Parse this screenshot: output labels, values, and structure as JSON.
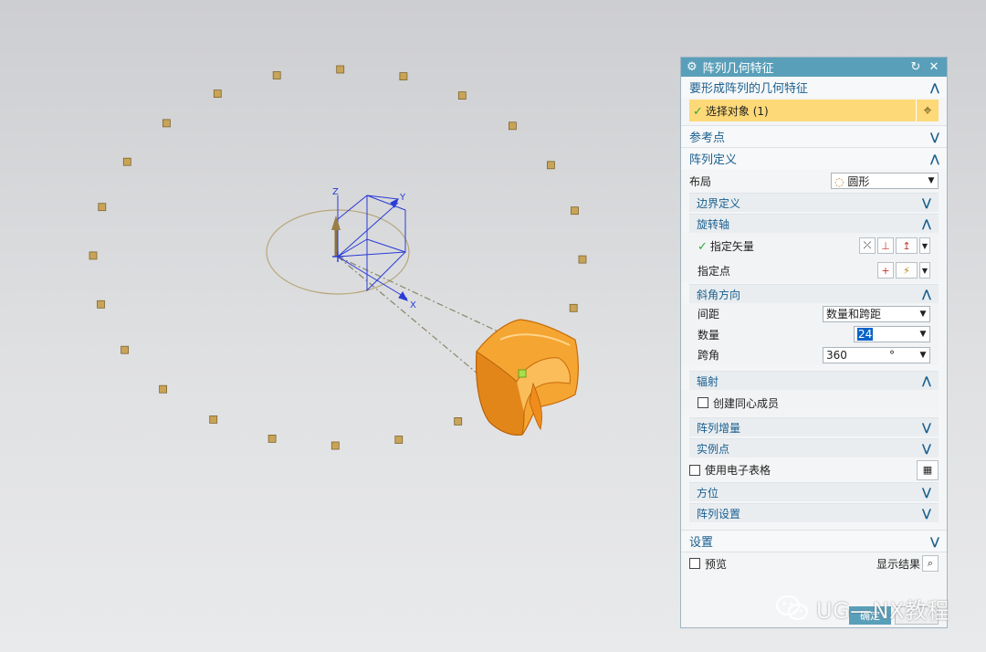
{
  "dialog": {
    "title": "阵列几何特征",
    "groups": {
      "features": {
        "label": "要形成阵列的几何特征",
        "select_label": "选择对象 (1)"
      },
      "reference_point": {
        "label": "参考点"
      },
      "array_def": {
        "label": "阵列定义",
        "layout_label": "布局",
        "layout_value": "圆形",
        "boundary": {
          "label": "边界定义"
        },
        "rotation_axis": {
          "label": "旋转轴",
          "vector_label": "指定矢量",
          "point_label": "指定点"
        },
        "angular_dir": {
          "label": "斜角方向",
          "spacing_label": "间距",
          "spacing_value": "数量和跨距",
          "count_label": "数量",
          "count_value": "24",
          "span_label": "跨角",
          "span_value": "360",
          "span_unit": "°"
        },
        "radial": {
          "label": "辐射",
          "concentric_label": "创建同心成员"
        },
        "increment": {
          "label": "阵列增量"
        },
        "instance_points": {
          "label": "实例点"
        },
        "spreadsheet_label": "使用电子表格",
        "orientation": {
          "label": "方位"
        },
        "array_settings": {
          "label": "阵列设置"
        }
      },
      "settings": {
        "label": "设置"
      }
    },
    "footer": {
      "preview_label": "预览",
      "show_result_label": "显示结果",
      "ok_label": "确定"
    }
  },
  "viewport": {
    "axis_labels": {
      "z": "Z",
      "y": "Y",
      "x": "X"
    }
  },
  "watermark": {
    "text": "UG—NX教程"
  },
  "colors": {
    "title_bar": "#5a9fb9",
    "group_text": "#1a5f8e",
    "selection_highlight": "#fed978",
    "part_orange": "#f7a53a",
    "marker": "#c9a457"
  }
}
